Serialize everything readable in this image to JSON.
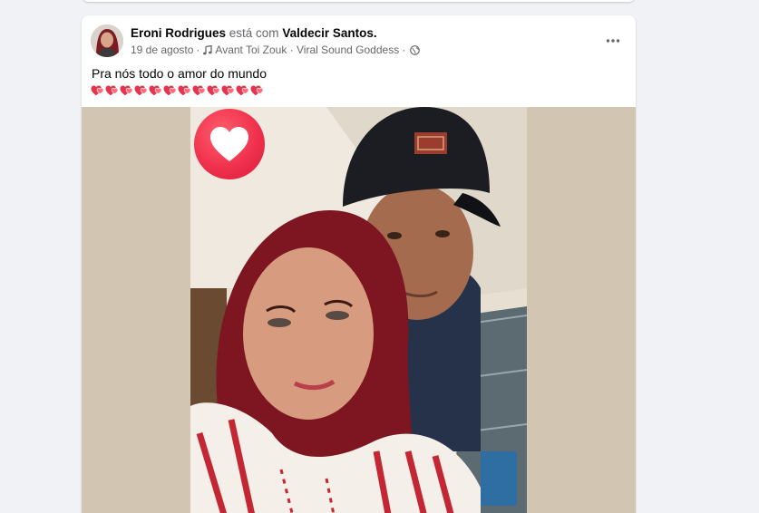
{
  "post": {
    "author_name": "Eroni Rodrigues",
    "with_text": "está com",
    "tagged_name": "Valdecir Santos.",
    "date": "19 de agosto",
    "separator": "·",
    "music": "Avant Toi Zouk · Viral Sound Goddess",
    "privacy_icon": "globe-icon",
    "text": "Pra nós todo o amor do mundo",
    "heart_emoji_count": 12,
    "more_icon": "more-horizontal-icon",
    "reaction_icon": "love-reaction-icon"
  },
  "colors": {
    "page_bg": "#f0f2f5",
    "card_bg": "#ffffff",
    "primary_text": "#050505",
    "secondary_text": "#65676b",
    "love_red": "#f0314d",
    "photo_bg": "#d2c6b2"
  }
}
